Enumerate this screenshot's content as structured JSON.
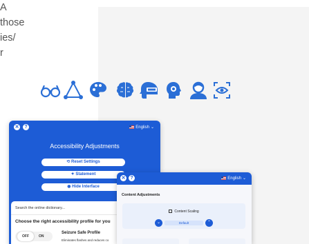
{
  "intro_lines": [
    "A",
    " those",
    "ies/",
    "r"
  ],
  "profile_icons": [
    "glasses-icon",
    "triangle-network-icon",
    "palette-icon",
    "brain-icon",
    "headset-visor-icon",
    "gear-head-icon",
    "person-icon",
    "eye-focus-icon"
  ],
  "colors": {
    "brand": "#1d5cd6",
    "icon": "#2b6fd6"
  },
  "panel1": {
    "language": "English",
    "title": "Accessibility Adjustments",
    "reset_label": "Reset Settings",
    "statement_label": "Statement",
    "hide_label": "Hide Interface",
    "search_placeholder": "Search the online dictionary...",
    "choose_label": "Choose the right accessibility profile for you",
    "toggle_off": "OFF",
    "toggle_on": "ON",
    "profile_title": "Seizure Safe Profile",
    "profile_desc": "Eliminates flashes and reduces co"
  },
  "panel2": {
    "language": "English",
    "section_title": "Content Adjustments",
    "scaling_label": "Content Scaling",
    "scaling_value": "Default"
  }
}
